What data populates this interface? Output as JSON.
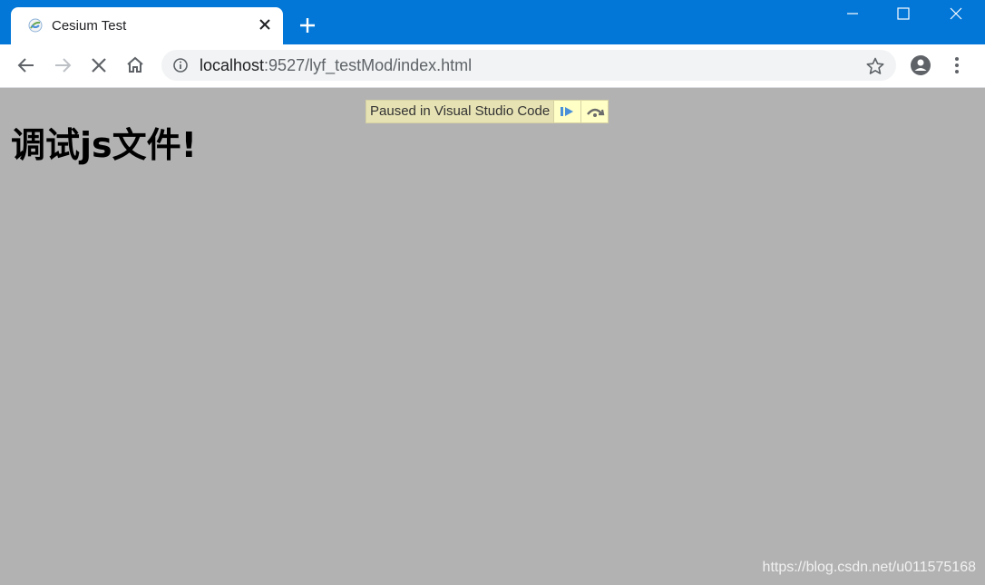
{
  "browser": {
    "tab": {
      "title": "Cesium Test",
      "favicon": "cesium-globe-icon"
    },
    "new_tab_icon": "plus-icon",
    "window_controls": [
      "minimize-icon",
      "maximize-icon",
      "close-icon"
    ],
    "toolbar": {
      "back_icon": "arrow-left-icon",
      "forward_icon": "arrow-right-icon",
      "stop_icon": "close-icon",
      "home_icon": "home-icon",
      "bookmark_icon": "star-icon",
      "profile_icon": "account-icon",
      "menu_icon": "more-vertical-icon"
    },
    "address": {
      "host": "localhost",
      "path": ":9527/lyf_testMod/index.html"
    }
  },
  "page": {
    "heading": "调试js文件!"
  },
  "debugger": {
    "status": "Paused in Visual Studio Code",
    "resume_icon": "resume-icon",
    "step_over_icon": "step-over-icon"
  },
  "watermark": "https://blog.csdn.net/u011575168",
  "colors": {
    "titlebar": "#0277d8",
    "viewport": "#b2b2b2",
    "debugger_bar": "#ffffc6"
  }
}
